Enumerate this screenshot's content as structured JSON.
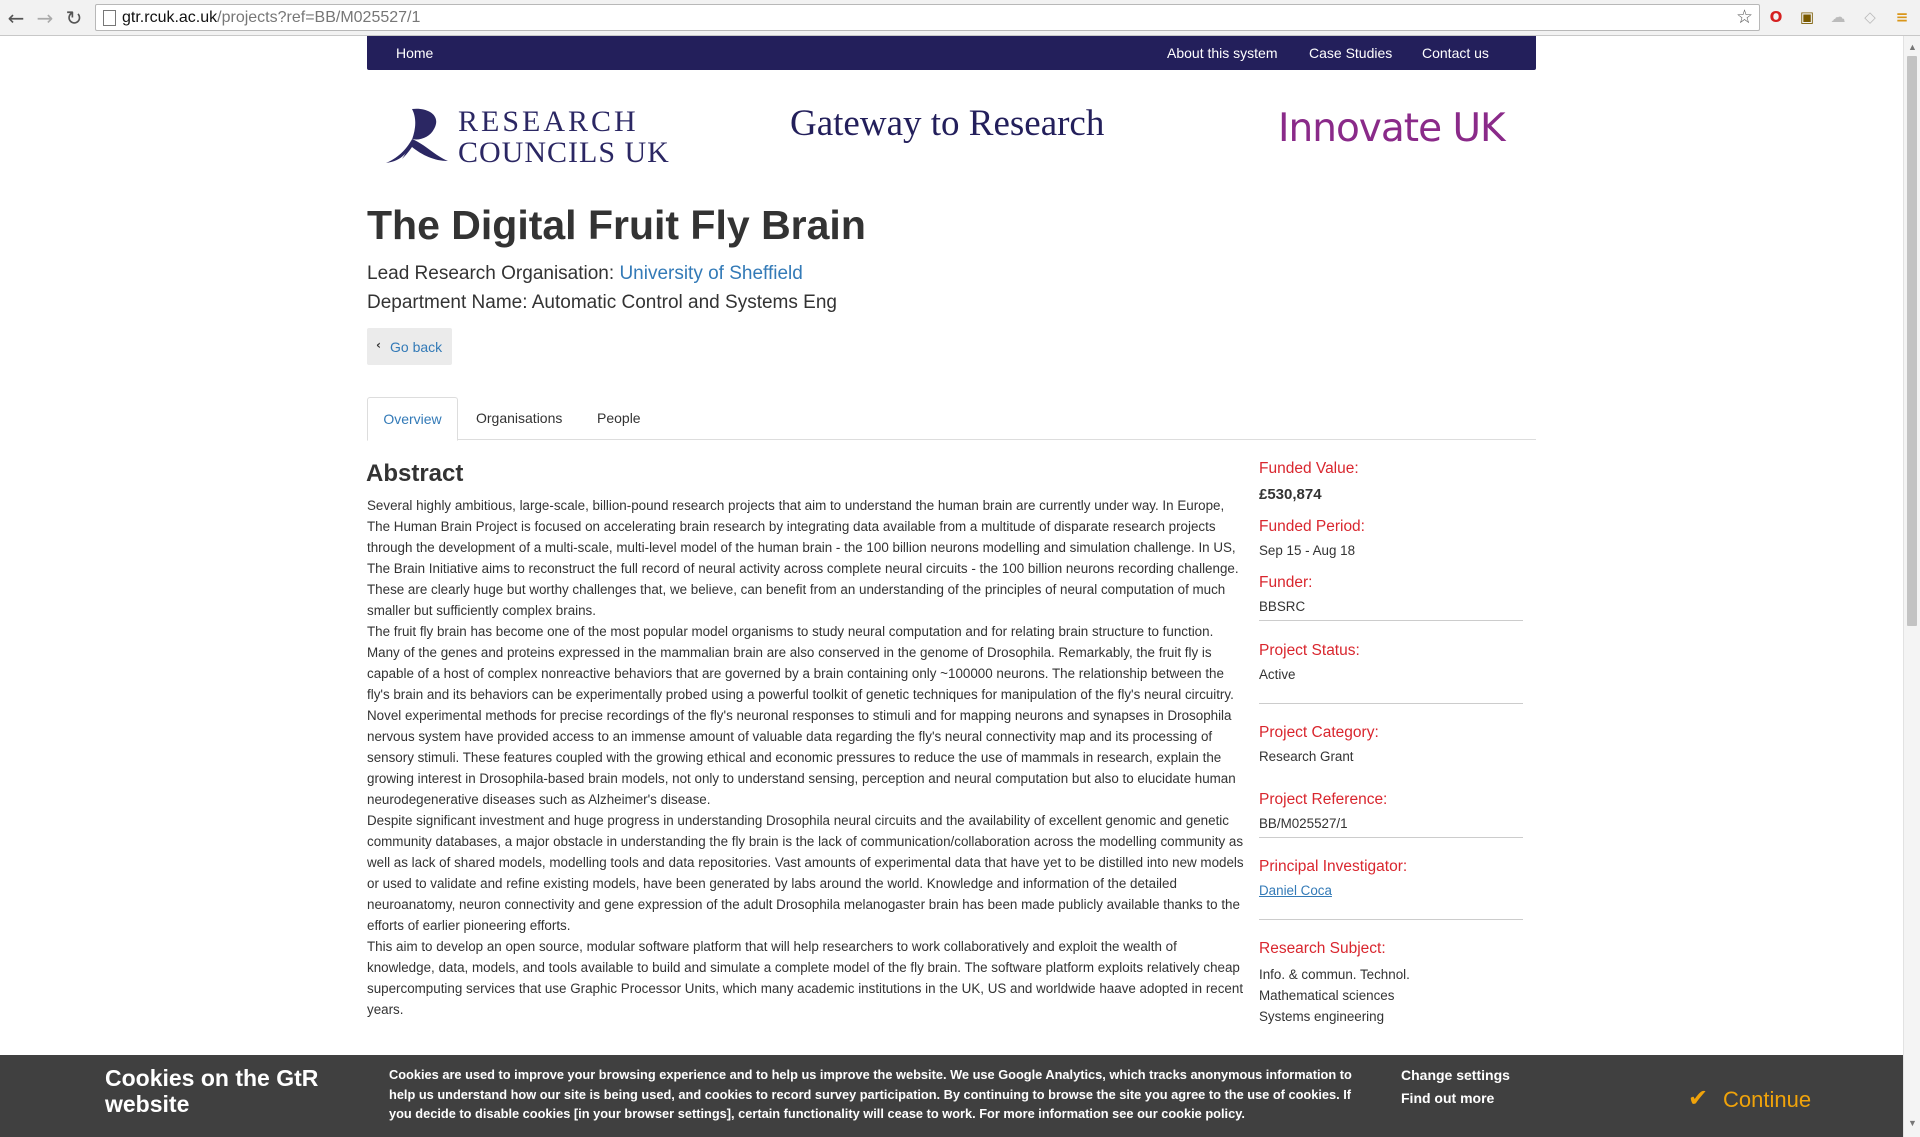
{
  "browser": {
    "url_host": "gtr.rcuk.ac.uk",
    "url_path": "/projects?ref=BB/M025527/1"
  },
  "nav": {
    "home": "Home",
    "about": "About this system",
    "case_studies": "Case Studies",
    "contact": "Contact us"
  },
  "branding": {
    "rcuk_line1": "RESEARCH",
    "rcuk_line2": "COUNCILS UK",
    "gateway": "Gateway to Research",
    "innovate": "Innovate UK",
    "rcuk_color": "#2b2763",
    "innovate_color": "#8a2a89"
  },
  "project": {
    "title": "The Digital Fruit Fly Brain",
    "lead_org_label": "Lead Research Organisation: ",
    "lead_org": "University of Sheffield",
    "dept_label": "Department Name: ",
    "dept": "Automatic Control and Systems Eng",
    "go_back": "Go back"
  },
  "tabs": [
    {
      "label": "Overview",
      "active": true
    },
    {
      "label": "Organisations",
      "active": false
    },
    {
      "label": "People",
      "active": false
    }
  ],
  "abstract": {
    "heading": "Abstract",
    "paragraphs": [
      "Several highly ambitious, large-scale, billion-pound research projects that aim to understand the human brain are currently under way. In Europe, The Human Brain Project is focused on accelerating brain research by integrating data available from a multitude of disparate research projects through the development of a multi-scale, multi-level model of the human brain - the 100 billion neurons modelling and simulation challenge. In US, The Brain Initiative aims to reconstruct the full record of neural activity across complete neural circuits - the 100 billion neurons recording challenge. These are clearly huge but worthy challenges that, we believe, can benefit from an understanding of the principles of neural computation of much smaller but sufficiently complex brains.",
      "The fruit fly brain has become one of the most popular model organisms to study neural computation and for relating brain structure to function. Many of the genes and proteins expressed in the mammalian brain are also conserved in the genome of Drosophila. Remarkably, the fruit fly is capable of a host of complex nonreactive behaviors that are governed by a brain containing only ~100000 neurons. The relationship between the fly's brain and its behaviors can be experimentally probed using a powerful toolkit of genetic techniques for manipulation of the fly's neural circuitry. Novel experimental methods for precise recordings of the fly's neuronal responses to stimuli and for mapping neurons and synapses in Drosophila nervous system have provided access to an immense amount of valuable data regarding the fly's neural connectivity map and its processing of sensory stimuli. These features coupled with the growing ethical and economic pressures to reduce the use of mammals in research, explain the growing interest in Drosophila-based brain models, not only to understand sensing, perception and neural computation but also to elucidate human neurodegenerative diseases such as Alzheimer's disease.",
      "Despite significant investment and huge progress in understanding Drosophila neural circuits and the availability of excellent genomic and genetic community databases, a major obstacle in understanding the fly brain is the lack of communication/collaboration across the modelling community as well as lack of shared models, modelling tools and data repositories. Vast amounts of experimental data that have yet to be distilled into new models or used to validate and refine existing models, have been generated by labs around the world. Knowledge and information of the detailed neuroanatomy, neuron connectivity and gene expression of the adult Drosophila melanogaster brain has been made publicly available thanks to the efforts of earlier pioneering efforts.",
      "This aim to develop an open source, modular software platform that will help researchers to work collaboratively and exploit the wealth of knowledge, data, models, and tools available to build and simulate a complete model of the fly brain. The software platform exploits relatively cheap supercomputing services that use Graphic Processor Units, which many academic institutions in the UK, US and worldwide haave adopted in recent years."
    ]
  },
  "sidebar": {
    "funded_value_label": "Funded Value:",
    "funded_value": "£530,874",
    "funded_period_label": "Funded Period:",
    "funded_period": "Sep 15 - Aug 18",
    "funder_label": "Funder:",
    "funder": "BBSRC",
    "status_label": "Project Status:",
    "status": "Active",
    "category_label": "Project Category:",
    "category": "Research Grant",
    "reference_label": "Project Reference:",
    "reference": "BB/M025527/1",
    "pi_label": "Principal Investigator:",
    "pi": "Daniel Coca",
    "subject_label": "Research Subject:",
    "subjects": [
      "Info. & commun. Technol.",
      "Mathematical sciences",
      "Systems engineering"
    ],
    "label_color": "#d9262e"
  },
  "cookie": {
    "title": "Cookies on the GtR website",
    "text": "Cookies are used to improve your browsing experience and to help us improve the website. We use Google Analytics, which tracks anonymous information to help us understand how our site is being used, and cookies to record survey participation. By continuing to browse the site you agree to the use of cookies. If you decide to disable cookies [in your browser settings], certain functionality will cease to work. For more information see our ",
    "policy_link": "cookie policy",
    "text_end": ".",
    "change_settings": "Change settings",
    "find_out_more": "Find out more",
    "continue": "Continue",
    "accent": "#f0a30a"
  }
}
